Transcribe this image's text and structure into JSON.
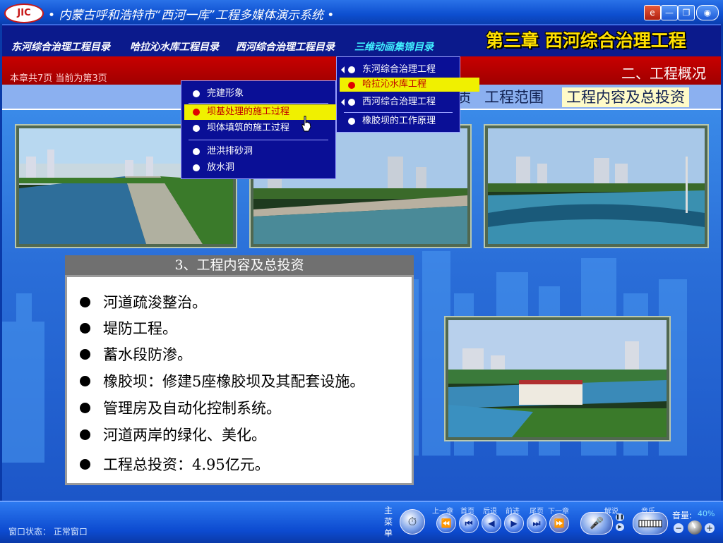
{
  "window": {
    "title": "内蒙古呼和浩特市“西河一库”工程多媒体演示系统",
    "logo_text": "JIC",
    "buttons": {
      "ie": "e",
      "minimize": "—",
      "restore": "❐",
      "close": "◉"
    }
  },
  "nav": {
    "links": [
      "东河综合治理工程目录",
      "哈拉沁水库工程目录",
      "西河综合治理工程目录",
      "三维动画集锦目录"
    ],
    "chapter_title": "第三章 西河综合治理工程"
  },
  "page_info": "本章共7页   当前为第3页",
  "section_title": "二、工程概况",
  "tabs": [
    {
      "label": "质",
      "active": false
    },
    {
      "label": "工程范围",
      "active": false
    },
    {
      "label": "工程内容及总投资",
      "active": true
    }
  ],
  "menu_left": [
    {
      "label": "完建形象",
      "highlighted": false
    },
    {
      "label": "坝基处理的施工过程",
      "highlighted": true
    },
    {
      "label": "坝体填筑的施工过程",
      "highlighted": false
    },
    {
      "label": "泄洪排砂洞",
      "highlighted": false
    },
    {
      "label": "放水洞",
      "highlighted": false
    }
  ],
  "menu_right": [
    {
      "label": "东河综合治理工程",
      "highlighted": false,
      "submenu": true
    },
    {
      "label": "哈拉沁水库工程",
      "highlighted": true,
      "submenu": false
    },
    {
      "label": "西河综合治理工程",
      "highlighted": false,
      "submenu": true
    },
    {
      "label": "橡胶坝的工作原理",
      "highlighted": false,
      "submenu": false
    }
  ],
  "content": {
    "heading": "3、工程内容及总投资",
    "bullets": [
      "河道疏浚整治。",
      "堤防工程。",
      "蓄水段防渗。",
      "橡胶坝：修建5座橡胶坝及其配套设施。",
      "管理房及自动化控制系统。",
      "河道两岸的绿化、美化。",
      "工程总投资：4.95亿元。"
    ]
  },
  "bottom": {
    "status": "窗口状态：  正常窗口",
    "main_menu": "主菜单",
    "controls": [
      {
        "label": "上一章",
        "icon": "⏪"
      },
      {
        "label": "首页",
        "icon": "⏮"
      },
      {
        "label": "后退",
        "icon": "◀"
      },
      {
        "label": "前进",
        "icon": "▶"
      },
      {
        "label": "尾页",
        "icon": "⏭"
      },
      {
        "label": "下一章",
        "icon": "⏩"
      }
    ],
    "narration_label": "解说",
    "music_label": "音乐",
    "volume_label": "音量:",
    "volume_value": "40%",
    "volume_level": 0.4
  }
}
